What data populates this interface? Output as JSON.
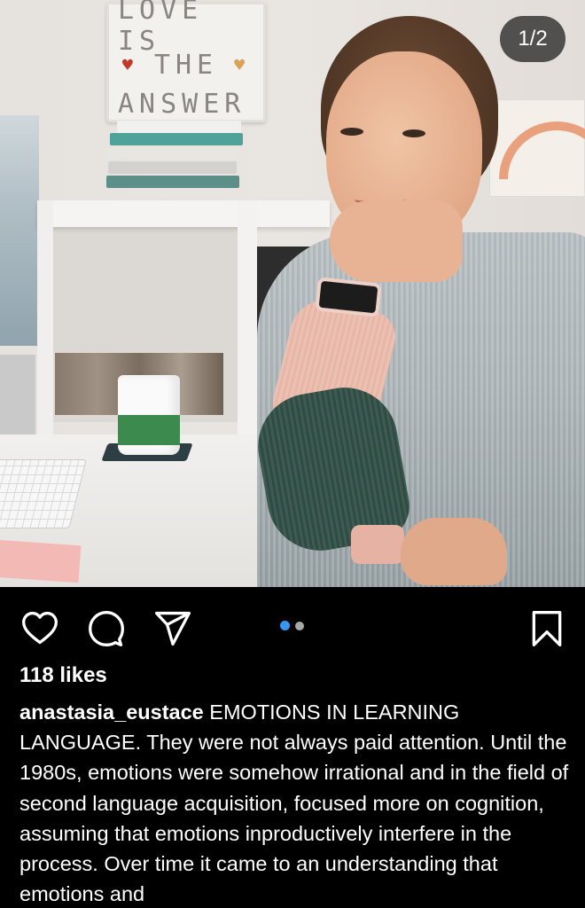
{
  "post": {
    "photo_alt": "Woman at desk with hand on chin",
    "lightbox": {
      "line1": "LOVE IS",
      "line2": "THE",
      "line3": "ANSWER"
    },
    "counter": "1/2",
    "carousel": {
      "total": 2,
      "active_index": 0
    }
  },
  "actions": {
    "like_icon": "heart-icon",
    "comment_icon": "comment-bubble-icon",
    "share_icon": "paper-plane-icon",
    "save_icon": "bookmark-icon"
  },
  "likes": "118 likes",
  "caption": {
    "username": "anastasia_eustace",
    "text": "EMOTIONS IN LEARNING LANGUAGE. They were not always paid attention. Until the 1980s, emotions were somehow irrational and in the field of second language acquisition, focused more on cognition, assuming that emotions inproductively interfere in the process. Over time it came to an understanding that emotions and"
  },
  "colors": {
    "background": "#000000",
    "text": "#ffffff",
    "carousel_active": "#3897f0",
    "carousel_inactive": "#a8a8a8"
  }
}
